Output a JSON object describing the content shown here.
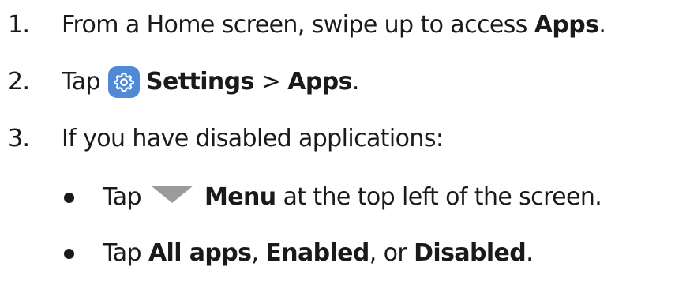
{
  "steps": [
    {
      "number": "1.",
      "before": "From a Home screen, swipe up to access ",
      "bold": "Apps",
      "after": "."
    },
    {
      "number": "2.",
      "before": "Tap",
      "bold1": "Settings",
      "separator": " > ",
      "bold2": "Apps",
      "after": "."
    },
    {
      "number": "3.",
      "text": "If you have disabled applications:"
    }
  ],
  "subitems": [
    {
      "before": "Tap",
      "bold": "Menu",
      "after": " at the top left of the screen."
    },
    {
      "before": "Tap ",
      "bold1": "All apps",
      "sep1": ", ",
      "bold2": "Enabled",
      "sep2": ", or ",
      "bold3": "Disabled",
      "after": "."
    }
  ],
  "icons": {
    "settings": "gear-icon",
    "menu": "dropdown-triangle-icon"
  },
  "colors": {
    "settings_icon_bg": "#4f8ad6",
    "menu_triangle": "#9b9b9b",
    "text": "#1a1a1a"
  }
}
